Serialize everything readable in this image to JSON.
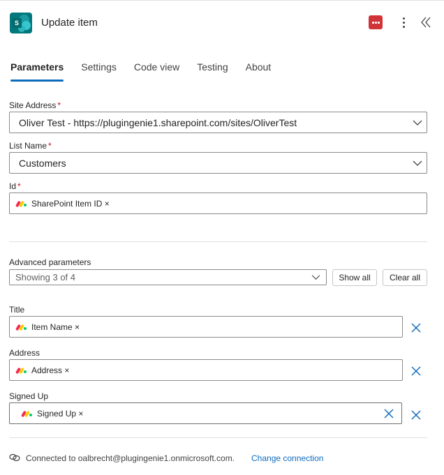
{
  "header": {
    "title": "Update item",
    "logo_letter": "S",
    "app_icon": "sharepoint-icon",
    "badge_icon": "more-dots-icon",
    "badge_color": "#d13438",
    "menu_icon": "more-vertical-icon",
    "collapse_icon": "double-chevron-left-icon"
  },
  "tabs": [
    {
      "label": "Parameters",
      "active": true
    },
    {
      "label": "Settings",
      "active": false
    },
    {
      "label": "Code view",
      "active": false
    },
    {
      "label": "Testing",
      "active": false
    },
    {
      "label": "About",
      "active": false
    }
  ],
  "fields": {
    "site_address": {
      "label": "Site Address",
      "required": "*",
      "value": "Oliver Test - https://plugingenie1.sharepoint.com/sites/OliverTest"
    },
    "list_name": {
      "label": "List Name",
      "required": "*",
      "value": "Customers"
    },
    "id": {
      "label": "Id",
      "required": "*",
      "token": "SharePoint Item ID ×"
    }
  },
  "advanced": {
    "label": "Advanced parameters",
    "select_value": "Showing 3 of 4",
    "show_all_label": "Show all",
    "clear_all_label": "Clear all"
  },
  "params": [
    {
      "label": "Title",
      "token": "Item Name ×"
    },
    {
      "label": "Address",
      "token": "Address ×"
    },
    {
      "label": "Signed Up",
      "token": "Signed Up ×"
    }
  ],
  "footer": {
    "connected_text": "Connected to oalbrecht@plugingenie1.onmicrosoft.com.",
    "change_link": "Change connection",
    "link_icon": "link-icon"
  },
  "colors": {
    "accent": "#0f6cbd",
    "required": "#c50f1f",
    "monday_red": "#f62b54",
    "monday_yellow": "#ffcb00",
    "monday_green": "#00ca72"
  }
}
